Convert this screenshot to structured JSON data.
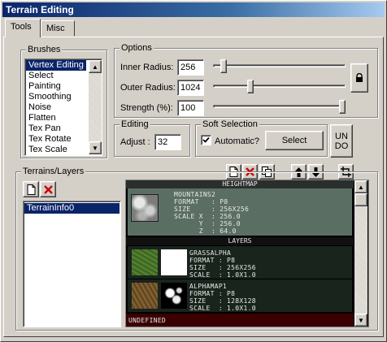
{
  "window": {
    "title": "Terrain Editing"
  },
  "tabs": [
    {
      "label": "Tools"
    },
    {
      "label": "Misc"
    }
  ],
  "brushes": {
    "title": "Brushes",
    "items": [
      "Vertex Editing",
      "Select",
      "Painting",
      "Smoothing",
      "Noise",
      "Flatten",
      "Tex Pan",
      "Tex Rotate",
      "Tex Scale"
    ],
    "selected": "Vertex Editing"
  },
  "options": {
    "title": "Options",
    "inner_radius": {
      "label": "Inner Radius:",
      "value": "256",
      "slider_fraction": 0.06
    },
    "outer_radius": {
      "label": "Outer Radius:",
      "value": "1024",
      "slider_fraction": 0.27
    },
    "strength": {
      "label": "Strength (%):",
      "value": "100",
      "slider_fraction": 1.0
    }
  },
  "editing": {
    "title": "Editing",
    "adjust_label": "Adjust :",
    "adjust_value": "32"
  },
  "soft_selection": {
    "title": "Soft Selection",
    "automatic_label": "Automatic?",
    "automatic_checked": true,
    "select_label": "Select"
  },
  "undo": {
    "label_line1": "UN",
    "label_line2": "DO"
  },
  "terrains": {
    "title": "Terrains/Layers",
    "list": [
      "TerrainInfo0"
    ],
    "selected": "TerrainInfo0"
  },
  "preview": {
    "heightmap_header": "HEIGHTMAP",
    "heightmap": {
      "name": "MOUNTAINS2",
      "format": "FORMAT   : P8",
      "size": "SIZE     : 256X256",
      "scale_x": "SCALE X  : 256.0",
      "scale_y": "      Y  : 256.0",
      "scale_z": "      Z  : 64.0"
    },
    "layers_header": "LAYERS",
    "layers": [
      {
        "name": "GRASSALPHA",
        "format": "FORMAT : P8",
        "size": "SIZE   : 256X256",
        "scale": "SCALE  : 1.0X1.0"
      },
      {
        "name": "ALPHAMAP1",
        "format": "FORMAT : P8",
        "size": "SIZE   : 128X128",
        "scale": "SCALE  : 1.0X1.0"
      }
    ],
    "undefined_label": "UNDEFINED"
  },
  "colors": {
    "title_start": "#0a246a",
    "heightmap_bg": "#5b6e63",
    "layers_bg": "#18241c",
    "undefined_bg": "#3a0000",
    "selection": "#0a246a"
  }
}
